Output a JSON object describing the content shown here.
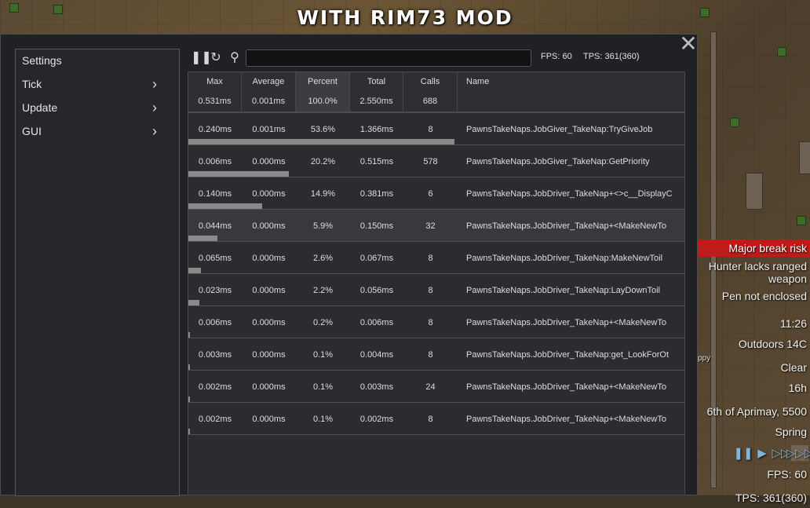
{
  "banner": "WITH RIM73 MOD",
  "window": {
    "sidebar": [
      {
        "label": "Settings",
        "chevron": false
      },
      {
        "label": "Tick",
        "chevron": true
      },
      {
        "label": "Update",
        "chevron": true
      },
      {
        "label": "GUI",
        "chevron": true
      }
    ],
    "toolbar": {
      "search_value": "",
      "fps": "FPS: 60",
      "tps": "TPS: 361(360)"
    },
    "table": {
      "columns": [
        {
          "title": "Max",
          "total": "0.531ms"
        },
        {
          "title": "Average",
          "total": "0.001ms"
        },
        {
          "title": "Percent",
          "total": "100.0%"
        },
        {
          "title": "Total",
          "total": "2.550ms"
        },
        {
          "title": "Calls",
          "total": "688"
        },
        {
          "title": "Name",
          "total": ""
        }
      ],
      "rows": [
        {
          "max": "0.240ms",
          "avg": "0.001ms",
          "pct": "53.6%",
          "total": "1.366ms",
          "calls": "8",
          "name": "PawnsTakeNaps.JobGiver_TakeNap:TryGiveJob",
          "pct_value": 53.6
        },
        {
          "max": "0.006ms",
          "avg": "0.000ms",
          "pct": "20.2%",
          "total": "0.515ms",
          "calls": "578",
          "name": "PawnsTakeNaps.JobGiver_TakeNap:GetPriority",
          "pct_value": 20.2
        },
        {
          "max": "0.140ms",
          "avg": "0.000ms",
          "pct": "14.9%",
          "total": "0.381ms",
          "calls": "6",
          "name": "PawnsTakeNaps.JobDriver_TakeNap+<>c__DisplayC",
          "pct_value": 14.9
        },
        {
          "max": "0.044ms",
          "avg": "0.000ms",
          "pct": "5.9%",
          "total": "0.150ms",
          "calls": "32",
          "name": "PawnsTakeNaps.JobDriver_TakeNap+<MakeNewTo",
          "pct_value": 5.9
        },
        {
          "max": "0.065ms",
          "avg": "0.000ms",
          "pct": "2.6%",
          "total": "0.067ms",
          "calls": "8",
          "name": "PawnsTakeNaps.JobDriver_TakeNap:MakeNewToil",
          "pct_value": 2.6
        },
        {
          "max": "0.023ms",
          "avg": "0.000ms",
          "pct": "2.2%",
          "total": "0.056ms",
          "calls": "8",
          "name": "PawnsTakeNaps.JobDriver_TakeNap:LayDownToil",
          "pct_value": 2.2
        },
        {
          "max": "0.006ms",
          "avg": "0.000ms",
          "pct": "0.2%",
          "total": "0.006ms",
          "calls": "8",
          "name": "PawnsTakeNaps.JobDriver_TakeNap+<MakeNewTo",
          "pct_value": 0.2
        },
        {
          "max": "0.003ms",
          "avg": "0.000ms",
          "pct": "0.1%",
          "total": "0.004ms",
          "calls": "8",
          "name": "PawnsTakeNaps.JobDriver_TakeNap:get_LookForOt",
          "pct_value": 0.1
        },
        {
          "max": "0.002ms",
          "avg": "0.000ms",
          "pct": "0.1%",
          "total": "0.003ms",
          "calls": "24",
          "name": "PawnsTakeNaps.JobDriver_TakeNap+<MakeNewTo",
          "pct_value": 0.1
        },
        {
          "max": "0.002ms",
          "avg": "0.000ms",
          "pct": "0.1%",
          "total": "0.002ms",
          "calls": "8",
          "name": "PawnsTakeNaps.JobDriver_TakeNap+<MakeNewTo",
          "pct_value": 0.1
        }
      ]
    }
  },
  "hud": {
    "alerts": [
      "Major break risk",
      "Hunter lacks ranged weapon",
      "Pen not enclosed"
    ],
    "time": "11:26",
    "temperature": "Outdoors 14C",
    "weather": "Clear",
    "hour": "16h",
    "date": "6th of Aprimay, 5500",
    "season": "Spring",
    "fps": "FPS: 60",
    "tps": "TPS: 361(360)",
    "pawn_label_fragment": "ppy"
  },
  "colors": {
    "alert_red": "#c01a1a",
    "window_bg": "#1f2124",
    "speed_icon": "#7fb3d9"
  }
}
